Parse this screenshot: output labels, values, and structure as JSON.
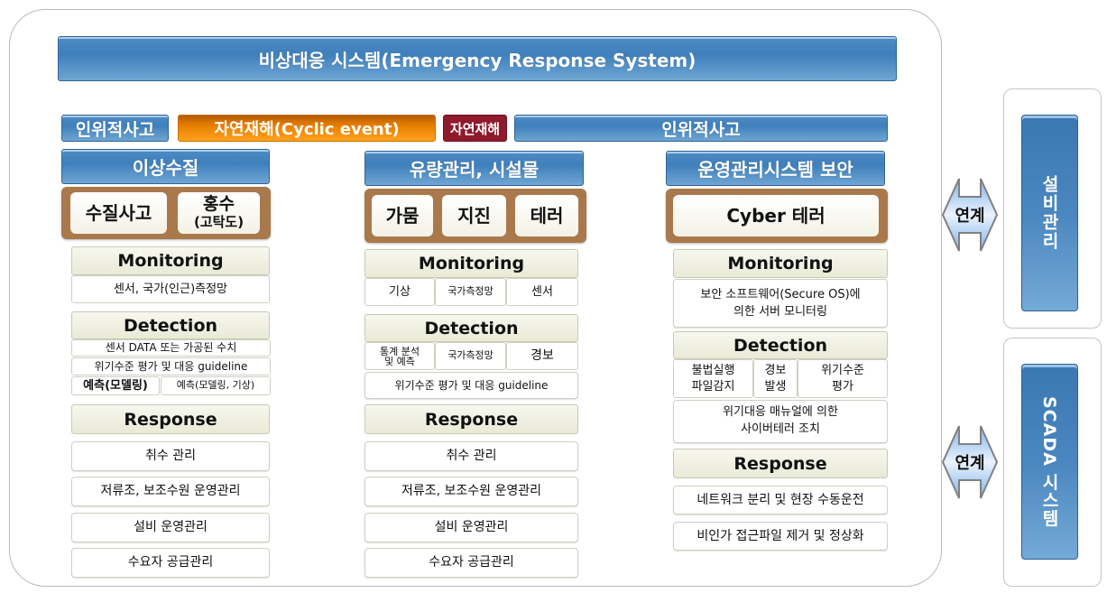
{
  "header": {
    "title": "비상대응 시스템(Emergency Response System)"
  },
  "category_bar": [
    {
      "label": "인위적사고",
      "color": "#4a86c0"
    },
    {
      "label": "자연재해(Cyclic event)",
      "color": "#e47b00"
    },
    {
      "label": "자연재해",
      "color": "#8e1a2c"
    },
    {
      "label": "인위적사고",
      "color": "#4a86c0"
    }
  ],
  "columns": [
    {
      "title": "이상수질",
      "events": [
        {
          "label": "수질사고",
          "sub": ""
        },
        {
          "label": "홍수",
          "sub": "(고탁도)"
        }
      ],
      "monitoring": {
        "label": "Monitoring",
        "items": [
          "센서, 국가(인근)측정망"
        ]
      },
      "detection": {
        "label": "Detection",
        "rows": [
          [
            "센서 DATA 또는 가공된 수치"
          ],
          [
            "위기수준 평가 및 대응 guideline"
          ],
          [
            "예측(모델링)",
            "예측(모델링, 기상)"
          ]
        ]
      },
      "response": {
        "label": "Response",
        "items": [
          "취수 관리",
          "저류조, 보조수원 운영관리",
          "설비 운영관리",
          "수요자 공급관리"
        ]
      }
    },
    {
      "title": "유량관리, 시설물",
      "events": [
        {
          "label": "가뭄",
          "sub": ""
        },
        {
          "label": "지진",
          "sub": ""
        },
        {
          "label": "테러",
          "sub": ""
        }
      ],
      "monitoring": {
        "label": "Monitoring",
        "items": [
          "기상",
          "국가측정망",
          "센서"
        ]
      },
      "detection": {
        "label": "Detection",
        "rows": [
          [
            "통계 분석\n및 예측",
            "국가측정망",
            "경보"
          ],
          [
            "위기수준 평가 및 대응 guideline"
          ]
        ]
      },
      "response": {
        "label": "Response",
        "items": [
          "취수 관리",
          "저류조, 보조수원 운영관리",
          "설비 운영관리",
          "수요자 공급관리"
        ]
      }
    },
    {
      "title": "운영관리시스템 보안",
      "events": [
        {
          "label": "Cyber 테러",
          "sub": ""
        }
      ],
      "monitoring": {
        "label": "Monitoring",
        "items": [
          "보안 소프트웨어(Secure OS)에\n의한 서버 모니터링"
        ]
      },
      "detection": {
        "label": "Detection",
        "rows": [
          [
            "불법실행\n파일감지",
            "경보\n발생",
            "위기수준\n평가"
          ],
          [
            "위기대응 매뉴얼에 의한\n사이버테러 조치"
          ]
        ]
      },
      "response": {
        "label": "Response",
        "items": [
          "네트워크 분리 및 현장 수동운전",
          "비인가 접근파일 제거 및 정상화"
        ]
      }
    }
  ],
  "links": [
    {
      "arrow_label": "연계",
      "system": "설비관리",
      "icon": "double-arrow-icon"
    },
    {
      "arrow_label": "연계",
      "system": "SCADA 시스템",
      "icon": "double-arrow-icon"
    }
  ]
}
